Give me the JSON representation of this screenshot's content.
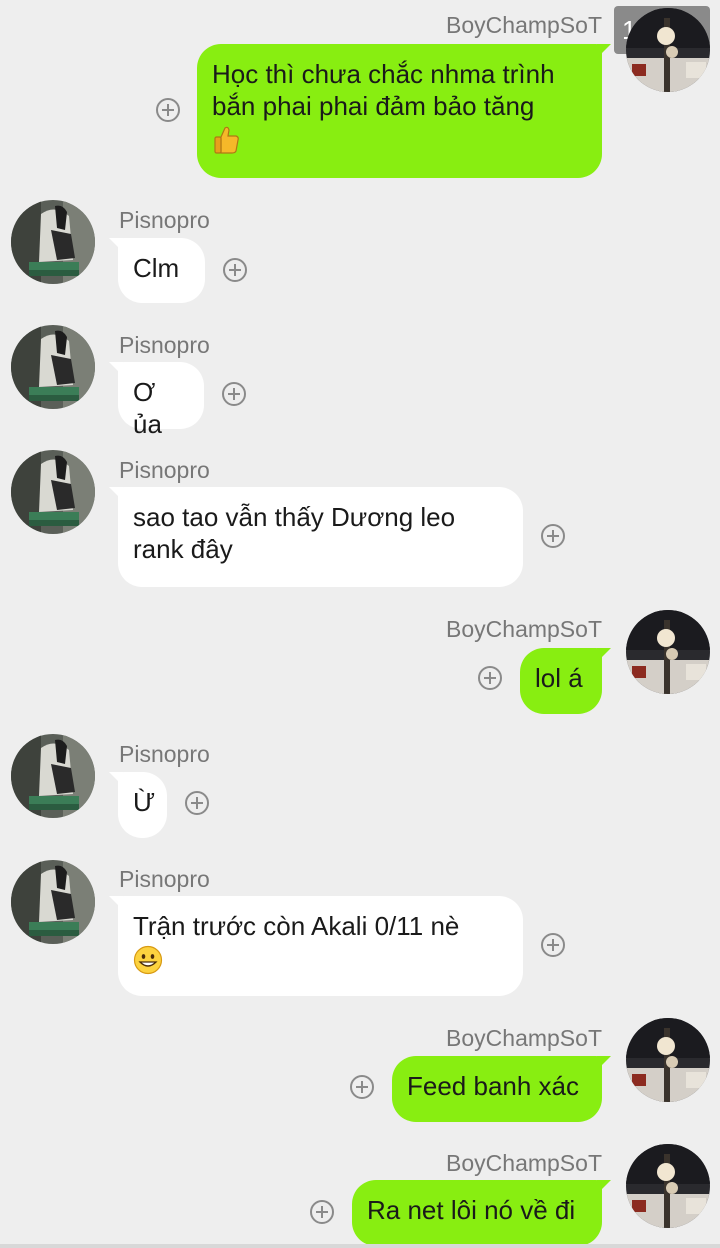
{
  "overlay_badge": "111 joy",
  "messages": [
    {
      "sender": "BoyChampSoT",
      "text_line1": "Học thì chưa chắc nhma trình",
      "text_line2": "bắn phai phai đảm bảo tăng",
      "emoji": "thumbs-up"
    },
    {
      "sender": "Pisnopro",
      "text": "Clm"
    },
    {
      "sender": "Pisnopro",
      "text": "Ơ ủa"
    },
    {
      "sender": "Pisnopro",
      "text_line1": "sao tao vẫn thấy Dương leo",
      "text_line2": "rank đây"
    },
    {
      "sender": "BoyChampSoT",
      "text": "lol á"
    },
    {
      "sender": "Pisnopro",
      "text": "Ừ"
    },
    {
      "sender": "Pisnopro",
      "text_line1": "Trận trước còn Akali 0/11 nè",
      "emoji": "grinning-face"
    },
    {
      "sender": "BoyChampSoT",
      "text": "Feed banh xác"
    },
    {
      "sender": "BoyChampSoT",
      "text": "Ra net lôi nó về đi"
    }
  ],
  "colors": {
    "background": "#eeeeee",
    "outgoing_bubble": "#88ee11",
    "incoming_bubble": "#ffffff",
    "sender_name": "#777777"
  }
}
